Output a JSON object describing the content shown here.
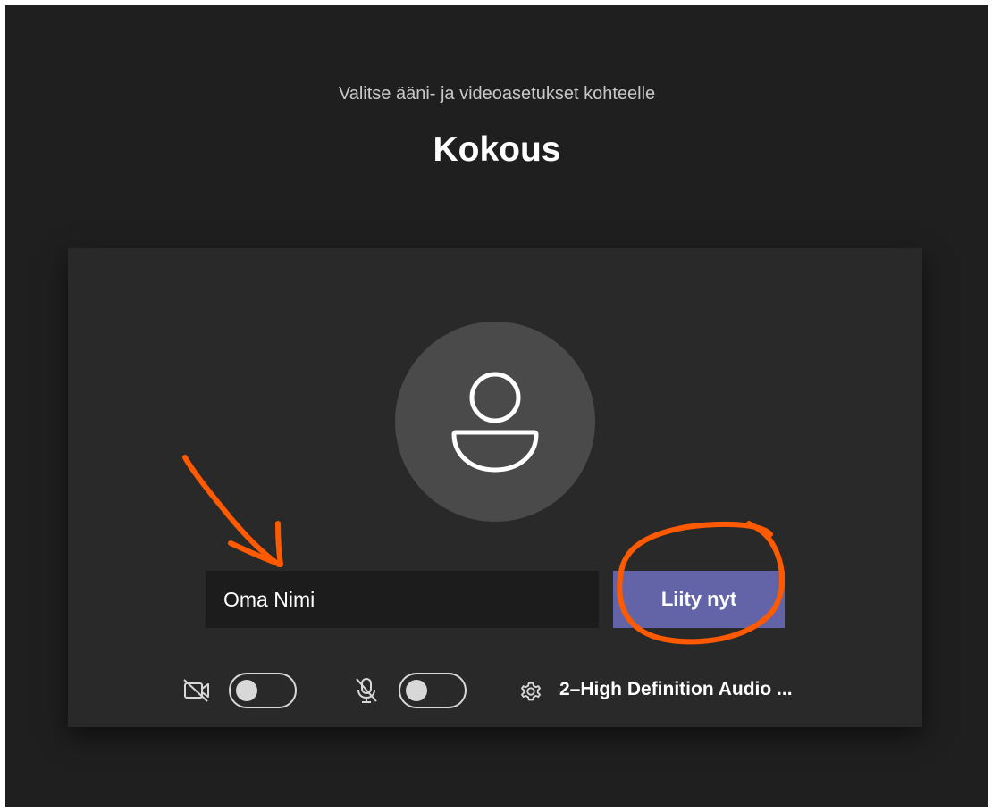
{
  "header": {
    "subtitle": "Valitse ääni- ja videoasetukset kohteelle",
    "title": "Kokous"
  },
  "join": {
    "name_value": "Oma Nimi",
    "button_label": "Liity nyt"
  },
  "controls": {
    "camera": {
      "icon": "camera-off-icon",
      "on": false
    },
    "microphone": {
      "icon": "mic-off-icon",
      "on": false
    },
    "device": {
      "icon": "gear-icon",
      "label": "2–High Definition Audio ..."
    }
  },
  "colors": {
    "background": "#1f1f1f",
    "card": "#292929",
    "avatar": "#4a4a4a",
    "input": "#1c1c1c",
    "accent": "#6264a7",
    "annotation": "#ff5a00"
  }
}
